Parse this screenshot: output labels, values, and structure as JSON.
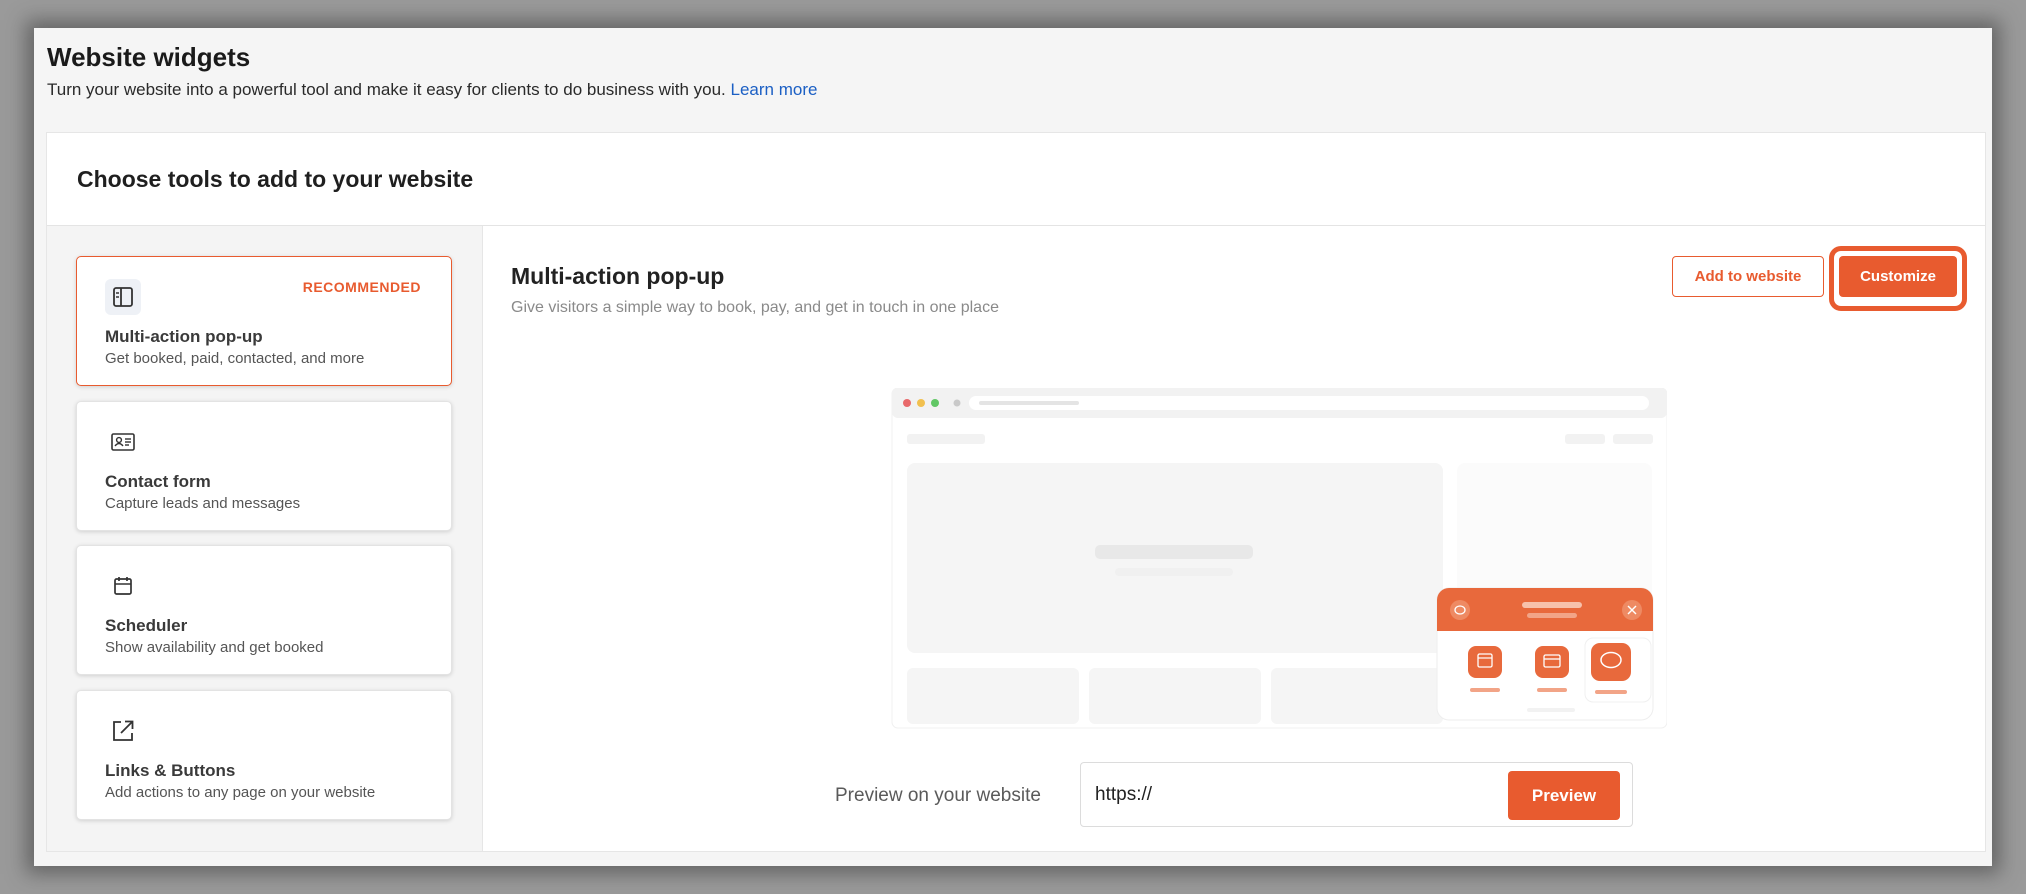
{
  "header": {
    "title": "Website widgets",
    "subtitle": "Turn your website into a powerful tool and make it easy for clients to do business with you.",
    "learn_more": "Learn more"
  },
  "panel": {
    "title": "Choose tools to add to your website"
  },
  "tools": [
    {
      "name": "Multi-action pop-up",
      "desc": "Get booked, paid, contacted, and more",
      "badge": "RECOMMENDED",
      "icon": "layout-panel-icon",
      "selected": true
    },
    {
      "name": "Contact form",
      "desc": "Capture leads and messages",
      "icon": "contact-card-icon"
    },
    {
      "name": "Scheduler",
      "desc": "Show availability and get booked",
      "icon": "calendar-icon"
    },
    {
      "name": "Links & Buttons",
      "desc": "Add actions to any page on your website",
      "icon": "external-link-icon"
    }
  ],
  "detail": {
    "title": "Multi-action pop-up",
    "subtitle": "Give visitors a simple way to book, pay, and get in touch in one place",
    "add_to_website": "Add to website",
    "customize": "Customize"
  },
  "preview": {
    "label": "Preview on your website",
    "input_value": "https://",
    "button": "Preview"
  },
  "colors": {
    "accent": "#e85b2f",
    "link": "#1b5fc4"
  }
}
